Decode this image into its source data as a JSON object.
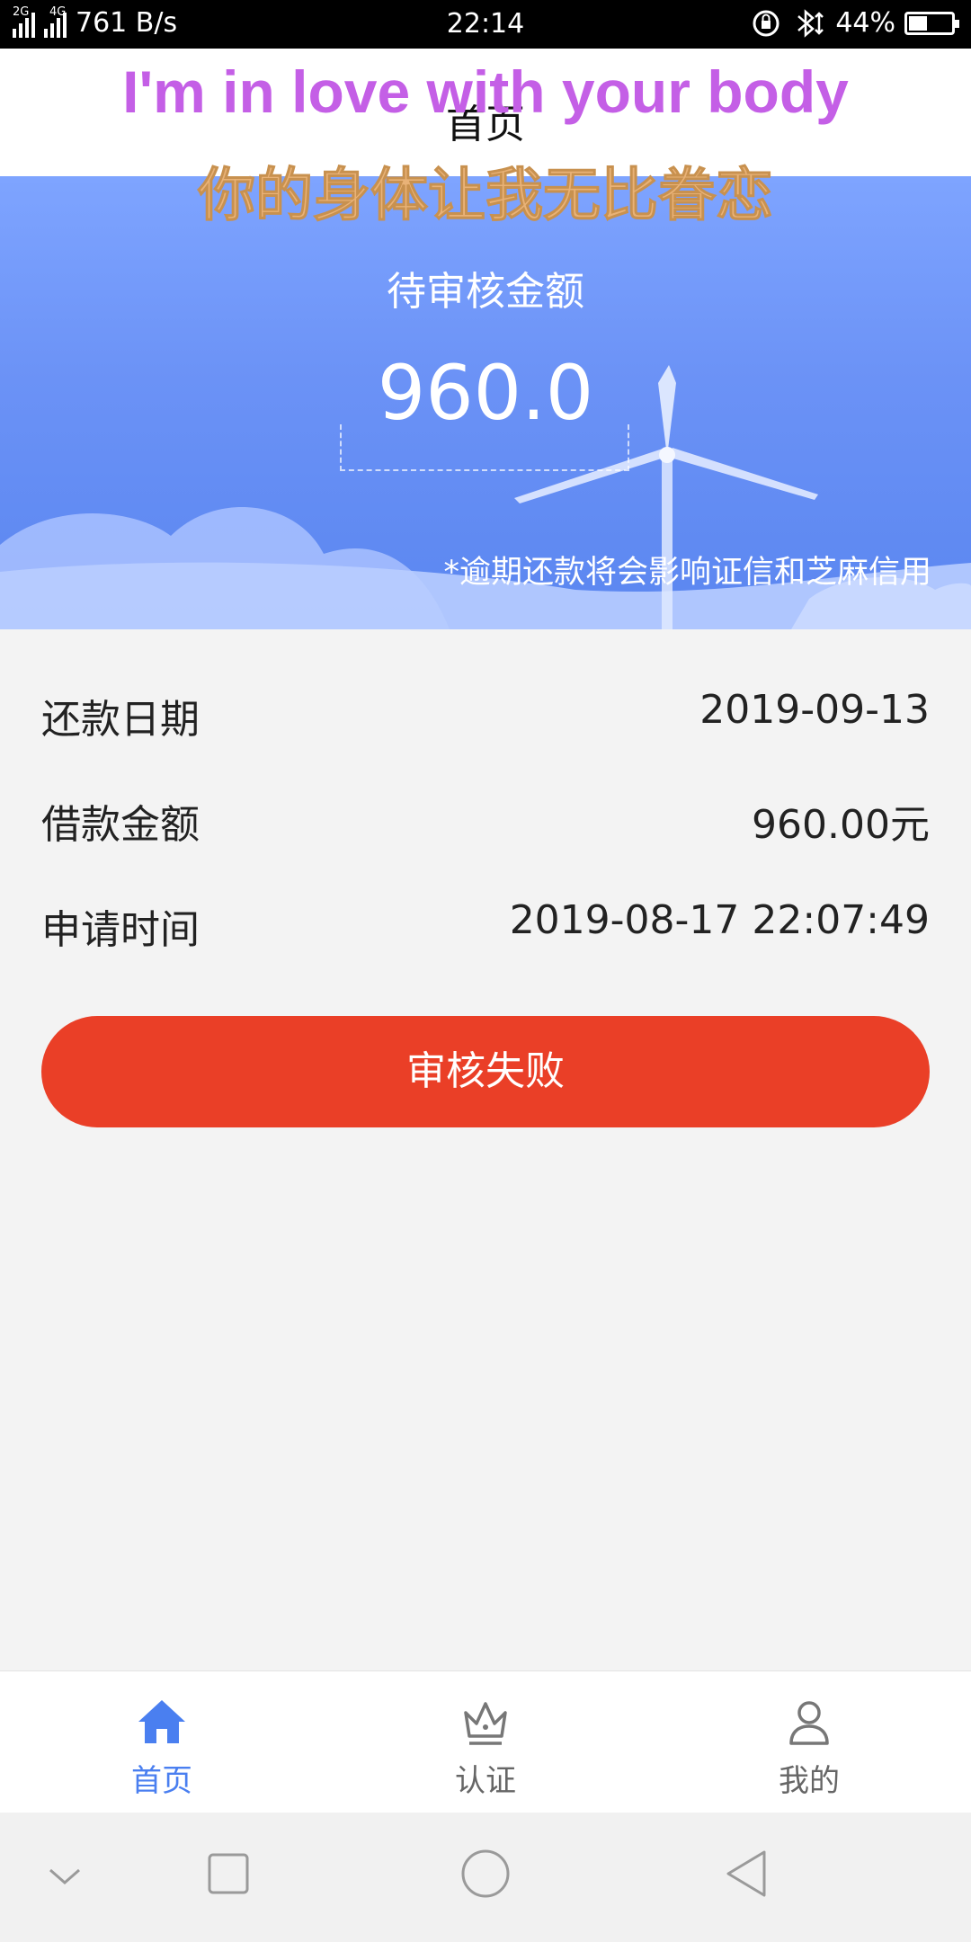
{
  "status_bar": {
    "network_tags": [
      "2G",
      "4G"
    ],
    "speed": "761 B/s",
    "time": "22:14",
    "battery": "44%",
    "battery_level": 0.44,
    "icons": [
      "rotation-lock-icon",
      "bluetooth-icon",
      "battery-icon"
    ]
  },
  "header": {
    "title": "首页"
  },
  "overlay": {
    "english": "I'm in love with your body",
    "chinese": "你的身体让我无比眷恋"
  },
  "banner": {
    "label": "待审核金额",
    "amount": "960.0",
    "note": "*逾期还款将会影响证信和芝麻信用"
  },
  "info": [
    {
      "label": "还款日期",
      "value": "2019-09-13"
    },
    {
      "label": "借款金额",
      "value": "960.00元"
    },
    {
      "label": "申请时间",
      "value": "2019-08-17 22:07:49"
    }
  ],
  "status_button": {
    "label": "审核失败"
  },
  "tabs": [
    {
      "label": "首页",
      "icon": "home-icon",
      "active": true
    },
    {
      "label": "认证",
      "icon": "crown-icon",
      "active": false
    },
    {
      "label": "我的",
      "icon": "user-icon",
      "active": false
    }
  ],
  "colors": {
    "accent": "#4a7ff0",
    "danger": "#ea3f27",
    "overlay_en": "#c45fe6",
    "overlay_cn": "#e9b277",
    "banner": "#6b92f6"
  }
}
